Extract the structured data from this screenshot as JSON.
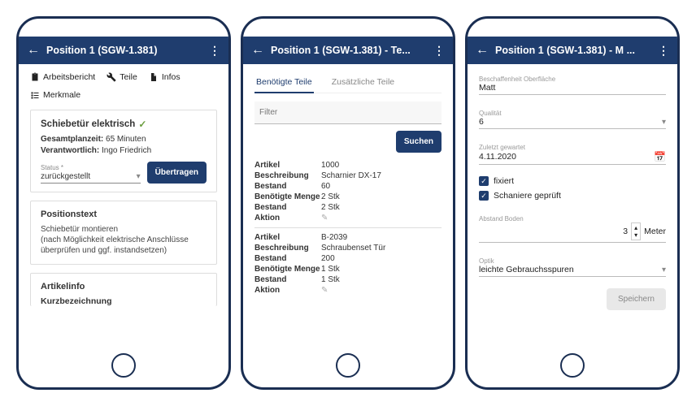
{
  "screen1": {
    "header": {
      "title": "Position 1 (SGW-1.381)"
    },
    "tabs": [
      {
        "label": "Arbeitsbericht",
        "icon": "clipboard-icon"
      },
      {
        "label": "Teile",
        "icon": "wrench-icon"
      },
      {
        "label": "Infos",
        "icon": "document-icon"
      },
      {
        "label": "Merkmale",
        "icon": "list-icon"
      }
    ],
    "task": {
      "title": "Schiebetür elektrisch",
      "plan_label": "Gesamtplanzeit:",
      "plan_value": "65 Minuten",
      "resp_label": "Verantwortlich:",
      "resp_value": "Ingo Friedrich",
      "status_label": "Status *",
      "status_value": "zurückgestellt",
      "transfer_btn": "Übertragen"
    },
    "position_text": {
      "heading": "Positionstext",
      "body": "Schiebetür montieren\n(nach Möglichkeit elektrische Anschlüsse überprüfen und ggf. instandsetzen)"
    },
    "article_info": {
      "heading": "Artikelinfo",
      "sub": "Kurzbezeichnung"
    }
  },
  "screen2": {
    "header": {
      "title": "Position 1 (SGW-1.381) - Te..."
    },
    "subtabs": {
      "required": "Benötigte Teile",
      "additional": "Zusätzliche Teile"
    },
    "filter_placeholder": "Filter",
    "search_btn": "Suchen",
    "labels": {
      "article": "Artikel",
      "desc": "Beschreibung",
      "stock": "Bestand",
      "needed": "Benötigte Menge",
      "stock2": "Bestand",
      "action": "Aktion"
    },
    "parts": [
      {
        "article": "1000",
        "desc": "Scharnier DX-17",
        "stock": "60",
        "needed": "2 Stk",
        "stock2": "2 Stk"
      },
      {
        "article": "B-2039",
        "desc": "Schraubenset Tür",
        "stock": "200",
        "needed": "1 Stk",
        "stock2": "1 Stk"
      }
    ]
  },
  "screen3": {
    "header": {
      "title": "Position 1 (SGW-1.381) - M ..."
    },
    "surface": {
      "label": "Beschaffenheit Oberfläche",
      "value": "Matt"
    },
    "quality": {
      "label": "Qualität",
      "value": "6"
    },
    "last_maint": {
      "label": "Zuletzt gewartet",
      "value": "4.11.2020"
    },
    "chk_fixed": "fixiert",
    "chk_hinges": "Schaniere geprüft",
    "distance": {
      "label": "Abstand Boden",
      "value": "3",
      "unit": "Meter"
    },
    "optics": {
      "label": "Optik",
      "value": "leichte Gebrauchsspuren"
    },
    "save_btn": "Speichern"
  }
}
